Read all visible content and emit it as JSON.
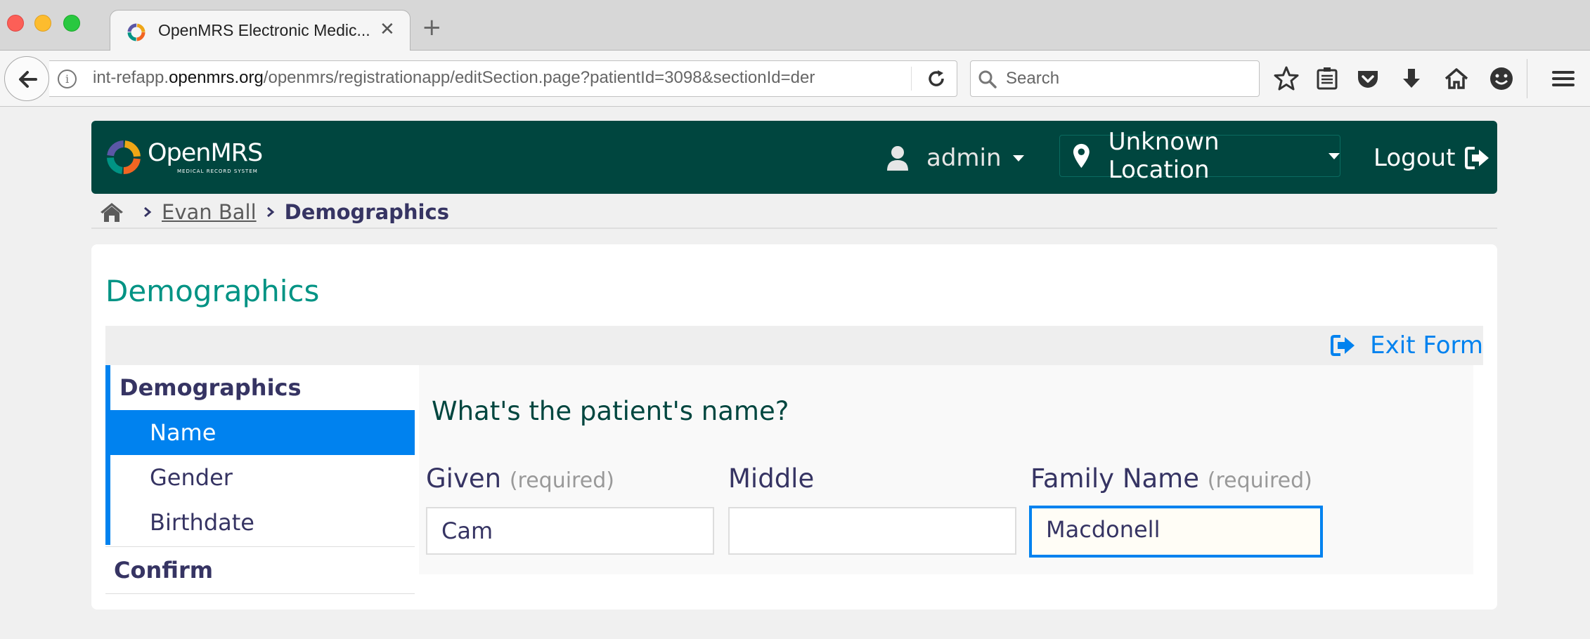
{
  "browser": {
    "tab_title": "OpenMRS Electronic Medic...",
    "tab_close": "✕",
    "new_tab": "+",
    "url_prefix": "int-refapp.",
    "url_host": "openmrs.org",
    "url_path": "/openmrs/registrationapp/editSection.page?patientId=3098&sectionId=der",
    "search_placeholder": "Search"
  },
  "header": {
    "logo_text": "OpenMRS",
    "logo_subtitle": "MEDICAL RECORD SYSTEM",
    "user": "admin",
    "location": "Unknown Location",
    "logout": "Logout"
  },
  "breadcrumb": {
    "patient": "Evan Ball",
    "current": "Demographics"
  },
  "page": {
    "title": "Demographics",
    "exit_form": "Exit Form"
  },
  "sidebar": {
    "section": "Demographics",
    "items": [
      {
        "label": "Name",
        "active": true
      },
      {
        "label": "Gender",
        "active": false
      },
      {
        "label": "Birthdate",
        "active": false
      }
    ],
    "confirm": "Confirm"
  },
  "form": {
    "question": "What's the patient's name?",
    "fields": [
      {
        "label": "Given",
        "required_note": "(required)",
        "value": "Cam"
      },
      {
        "label": "Middle",
        "required_note": "",
        "value": ""
      },
      {
        "label": "Family Name",
        "required_note": "(required)",
        "value": "Macdonell"
      }
    ]
  },
  "colors": {
    "header_bg": "#00463f",
    "accent_blue": "#0082ef",
    "title_teal": "#009384",
    "text_navy": "#363463"
  }
}
